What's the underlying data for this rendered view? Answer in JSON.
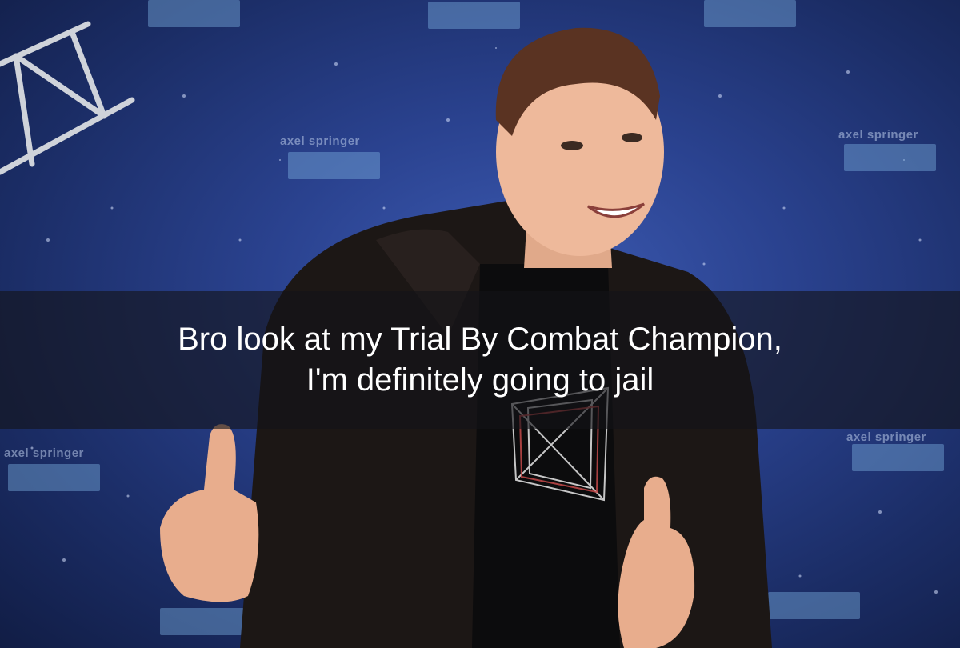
{
  "meme": {
    "caption": "Bro look at my Trial By Combat Champion,\nI'm definitely going to jail"
  },
  "backdrop": {
    "logo_text": "axel springer",
    "colors": {
      "backdrop": "#2a428f",
      "caption_band": "#141418",
      "caption_text": "#ffffff"
    }
  },
  "icons": {
    "gesture": "thumbs-up-icon"
  }
}
